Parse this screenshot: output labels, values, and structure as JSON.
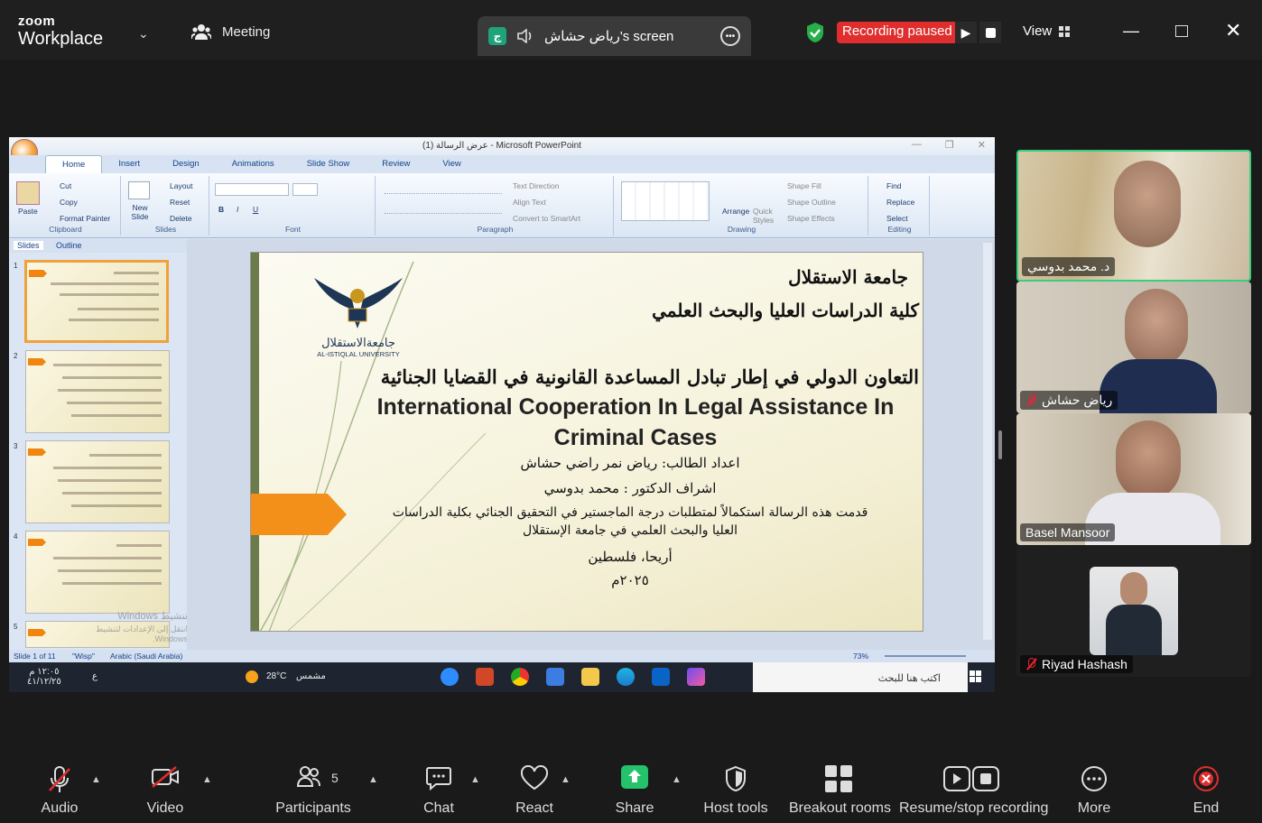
{
  "topbar": {
    "logo_line1": "zoom",
    "logo_line2": "Workplace",
    "meeting_label": "Meeting",
    "share_tag": "ج",
    "share_label": "رياض حشاش's screen",
    "recording_label": "Recording paused",
    "view_label": "View"
  },
  "powerpoint": {
    "window_title": "عرض الرسالة (1) - Microsoft PowerPoint",
    "tabs": [
      "Home",
      "Insert",
      "Design",
      "Animations",
      "Slide Show",
      "Review",
      "View"
    ],
    "active_tab": "Home",
    "ribbon": {
      "clipboard": {
        "paste": "Paste",
        "cut": "Cut",
        "copy": "Copy",
        "format_painter": "Format Painter",
        "group": "Clipboard"
      },
      "slides": {
        "new_slide": "New Slide",
        "layout": "Layout",
        "reset": "Reset",
        "delete": "Delete",
        "group": "Slides"
      },
      "font_group": "Font",
      "paragraph": {
        "text_direction": "Text Direction",
        "align_text": "Align Text",
        "convert": "Convert to SmartArt",
        "group": "Paragraph"
      },
      "drawing": {
        "arrange": "Arrange",
        "quick_styles": "Quick Styles",
        "shape_fill": "Shape Fill",
        "shape_outline": "Shape Outline",
        "shape_effects": "Shape Effects",
        "group": "Drawing"
      },
      "editing": {
        "find": "Find",
        "replace": "Replace",
        "select": "Select",
        "group": "Editing"
      }
    },
    "pane_tabs": [
      "Slides",
      "Outline"
    ],
    "thumb_numbers": [
      "1",
      "2",
      "3",
      "4",
      "5"
    ],
    "watermark_line1": "تنشيط Windows",
    "watermark_line2": "انتقل إلى الإعدادات لتنشيط Windows.",
    "slide": {
      "univ_line1": "جامعة الاستقلال",
      "univ_line2": "كلية الدراسات العليا والبحث العلمي",
      "logo_ar": "جامعةالاستقلال",
      "logo_en": "AL-ISTIQLAL UNIVERSITY",
      "title_ar": "التعاون الدولي في إطار تبادل المساعدة القانونية في القضايا الجنائية",
      "title_en": "International Cooperation In Legal Assistance In Criminal Cases",
      "student": "اعداد الطالب: رياض نمر راضي حشاش",
      "supervisor": "اشراف الدكتور : محمد بدوسي",
      "submitted1": "قدمت هذه الرسالة استكمالاً لمتطلبات درجة الماجستير في التحقيق الجنائي بكلية الدراسات",
      "submitted2": "العليا والبحث العلمي في جامعة الإستقلال",
      "place": "أريحا، فلسطين",
      "year": "٢٠٢٥م"
    },
    "status": {
      "slide_of": "Slide 1 of 11",
      "theme": "\"Wisp\"",
      "language": "Arabic (Saudi Arabia)",
      "zoom": "73%"
    }
  },
  "taskbar": {
    "time": "١٢:٠٥ م",
    "date": "٤١/١٢/٢٥",
    "lang": "ع",
    "temperature": "28°C",
    "weather": "مشمس",
    "search_placeholder": "اكتب هنا للبحث"
  },
  "participants": [
    {
      "name": "د. محمد بدوسي",
      "muted": false,
      "active": true
    },
    {
      "name": "رياض حشاش",
      "muted": true,
      "active": false
    },
    {
      "name": "Basel Mansoor",
      "muted": false,
      "active": false
    },
    {
      "name": "Riyad Hashash",
      "muted": true,
      "active": false
    }
  ],
  "toolbar": {
    "audio": "Audio",
    "video": "Video",
    "participants": "Participants",
    "participants_count": "5",
    "chat": "Chat",
    "react": "React",
    "share": "Share",
    "host_tools": "Host tools",
    "breakout": "Breakout rooms",
    "recording": "Resume/stop recording",
    "more": "More",
    "end": "End"
  },
  "colors": {
    "accent_green": "#1ea37a",
    "record_red": "#e02e2e",
    "share_green": "#23c26b",
    "slide_orange": "#f29019"
  }
}
